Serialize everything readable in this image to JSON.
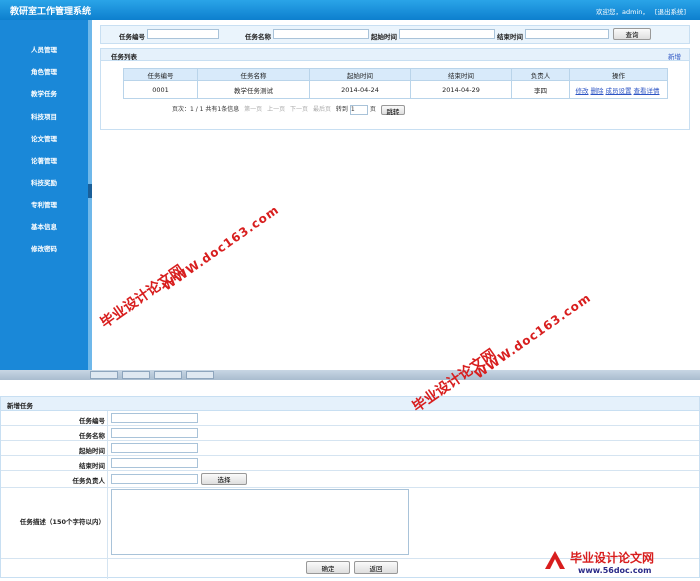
{
  "header": {
    "app_title": "教研室工作管理系统",
    "welcome": "欢迎您，admin，",
    "logout": "[退出系统]"
  },
  "sidebar": {
    "items": [
      {
        "label": "人员管理"
      },
      {
        "label": "角色管理"
      },
      {
        "label": "教学任务"
      },
      {
        "label": "科技项目"
      },
      {
        "label": "论文管理"
      },
      {
        "label": "论著管理"
      },
      {
        "label": "科技奖励"
      },
      {
        "label": "专利管理"
      },
      {
        "label": "基本信息"
      },
      {
        "label": "修改密码"
      }
    ]
  },
  "search": {
    "task_no_label": "任务编号",
    "task_name_label": "任务名称",
    "start_label": "起始时间",
    "end_label": "结束时间",
    "query_button": "查询"
  },
  "list": {
    "title": "任务列表",
    "add_link": "新增",
    "columns": [
      "任务编号",
      "任务名称",
      "起始时间",
      "结束时间",
      "负责人",
      "操作"
    ],
    "rows": [
      {
        "no": "0001",
        "name": "教学任务测试",
        "start": "2014-04-24",
        "end": "2014-04-29",
        "owner": "李四"
      }
    ],
    "ops": [
      "修改",
      "删除",
      "成员设置",
      "查看详情"
    ],
    "pager": {
      "summary": "页次：1 / 1 共有1条信息",
      "first": "第一页",
      "prev": "上一页",
      "next": "下一页",
      "last": "最后页",
      "goto_label": "转到",
      "goto_value": "1",
      "page_unit": "页",
      "jump_button": "跳转"
    }
  },
  "form": {
    "title": "新增任务",
    "fields": {
      "task_no": "任务编号",
      "task_name": "任务名称",
      "start": "起始时间",
      "end": "结束时间",
      "owner": "任务负责人",
      "desc": "任务描述（150个字符以内）"
    },
    "select_button": "选择",
    "confirm_button": "确定",
    "back_button": "返回"
  },
  "watermark": {
    "text": "毕业设计论文网",
    "url": "WWW.doc163.com",
    "logo_title": "毕业设计论文网",
    "logo_url": "www.56doc.com"
  },
  "colors": {
    "header": "#0d7fce",
    "sidebar": "#1a88d8",
    "watermark": "#d81e1e",
    "link": "#2d55c4"
  }
}
